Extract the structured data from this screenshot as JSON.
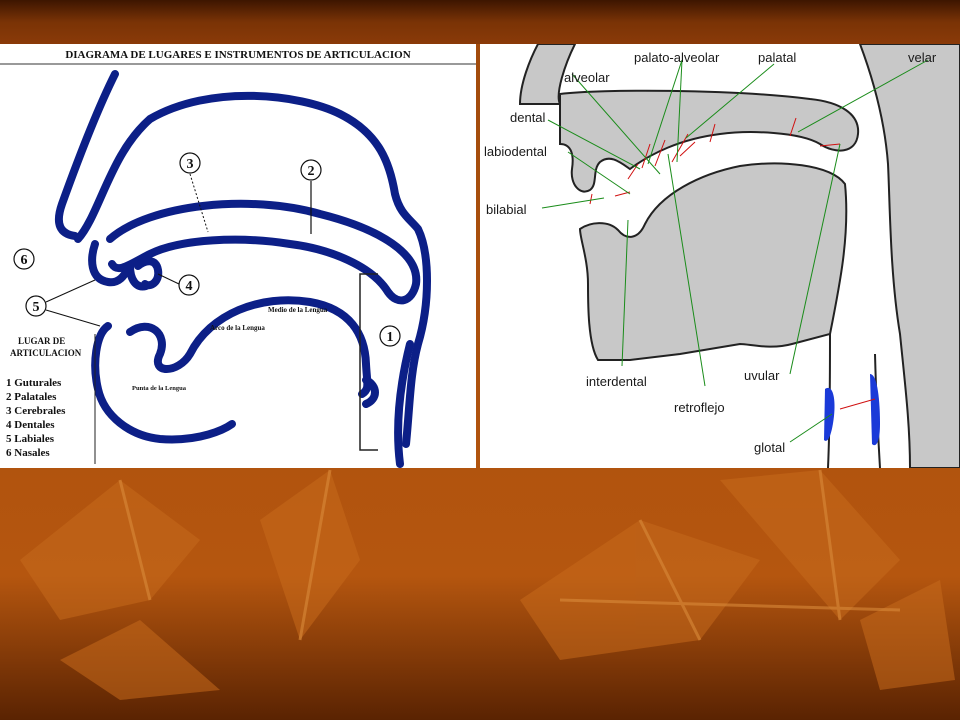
{
  "slide": {
    "colors": {
      "top_band": "#6b2a02",
      "background": "#b0500e",
      "leaf": "#c86a18"
    }
  },
  "left_diagram": {
    "title": "DIAGRAMA DE LUGARES E INSTRUMENTOS DE ARTICULACION",
    "stroke_color": "#0c1f87",
    "numbers": [
      "1",
      "2",
      "3",
      "4",
      "5",
      "6"
    ],
    "tongue_labels": {
      "middle": "Medio de la Lengua",
      "arch": "Arco de la Lengua",
      "tip": "Punta de la Lengua"
    },
    "legend": {
      "title_line1": "LUGAR DE",
      "title_line2": "ARTICULACION",
      "items": [
        "1 Guturales",
        "2 Palatales",
        "3 Cerebrales",
        "4 Dentales",
        "5 Labiales",
        "6 Nasales"
      ]
    }
  },
  "right_diagram": {
    "line_color": "#1a8c1a",
    "fill_color": "#c8c8c8",
    "labels": {
      "palato_alveolar": "palato-alveolar",
      "palatal": "palatal",
      "velar": "velar",
      "alveolar": "alveolar",
      "dental": "dental",
      "labiodental": "labiodental",
      "bilabial": "bilabial",
      "interdental": "interdental",
      "uvular": "uvular",
      "retroflejo": "retroflejo",
      "glotal": "glotal"
    }
  }
}
